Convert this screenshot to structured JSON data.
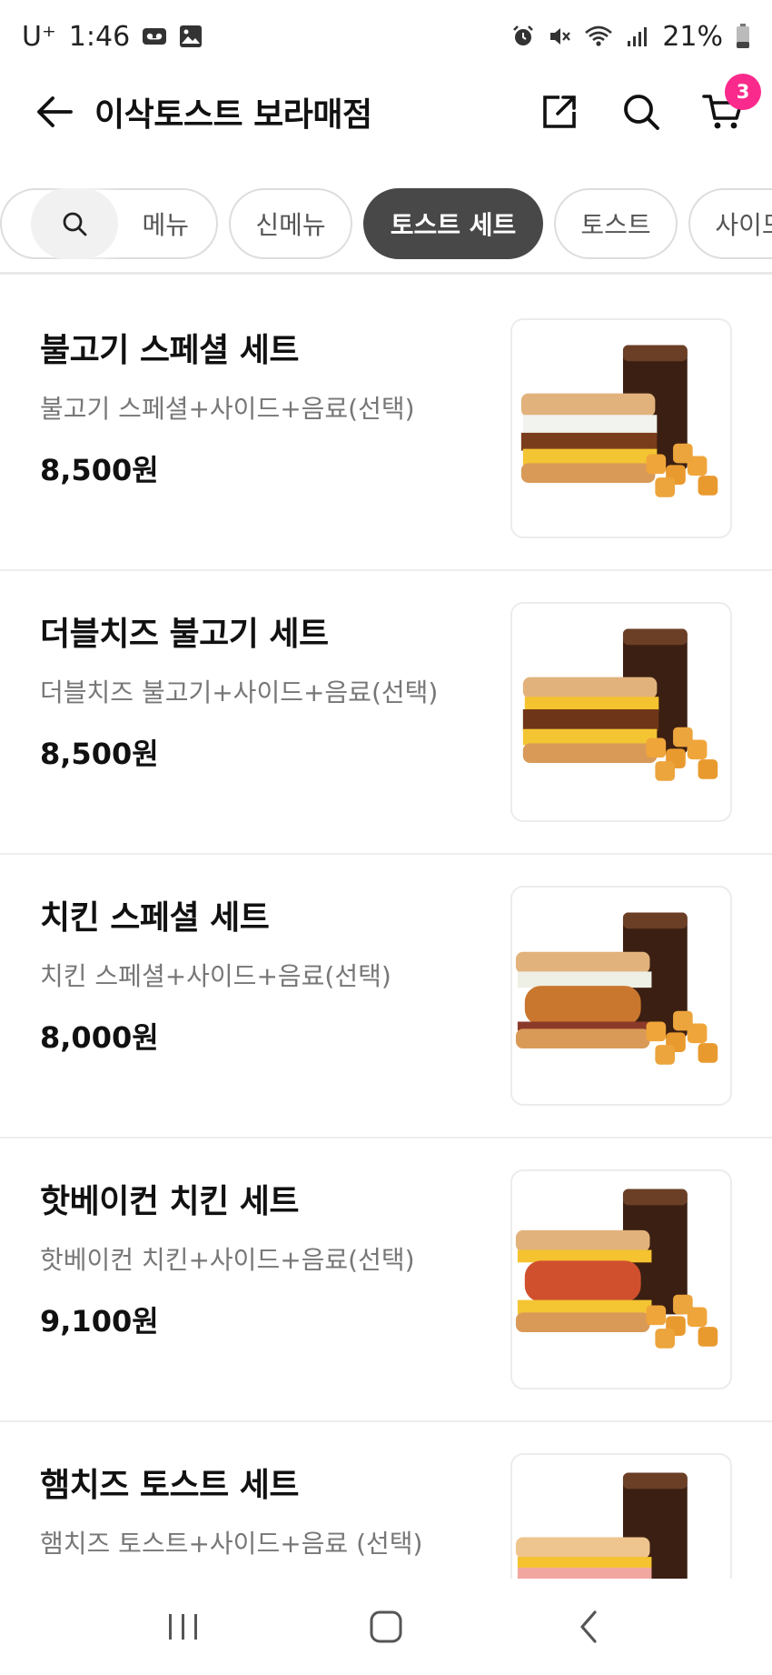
{
  "status_bar": {
    "carrier": "U⁺",
    "time": "1:46",
    "battery": "21%",
    "icons": [
      "voicemail-icon",
      "image-icon",
      "alarm-icon",
      "mute-icon",
      "wifi-icon",
      "signal-icon",
      "battery-icon"
    ]
  },
  "header": {
    "title": "이삭토스트 보라매점",
    "cart_count": "3",
    "icons": [
      "back-arrow-icon",
      "share-icon",
      "search-icon",
      "cart-icon"
    ]
  },
  "tabs": {
    "items": [
      {
        "label": "메뉴",
        "active": false
      },
      {
        "label": "신메뉴",
        "active": false
      },
      {
        "label": "토스트 세트",
        "active": true
      },
      {
        "label": "토스트",
        "active": false
      },
      {
        "label": "사이드",
        "active": false
      },
      {
        "label": "",
        "active": false
      }
    ]
  },
  "menu": {
    "items": [
      {
        "name": "불고기 스페셜 세트",
        "desc": "불고기 스페셜+사이드+음료(선택)",
        "price": "8,500원"
      },
      {
        "name": "더블치즈 불고기 세트",
        "desc": "더블치즈 불고기+사이드+음료(선택)",
        "price": "8,500원"
      },
      {
        "name": "치킨 스페셜 세트",
        "desc": "치킨 스페셜+사이드+음료(선택)",
        "price": "8,000원"
      },
      {
        "name": "핫베이컨 치킨 세트",
        "desc": "핫베이컨 치킨+사이드+음료(선택)",
        "price": "9,100원"
      },
      {
        "name": "햄치즈 토스트 세트",
        "desc": "햄치즈 토스트+사이드+음료 (선택)",
        "price": ""
      }
    ]
  },
  "nav": {
    "icons": [
      "recent-apps-icon",
      "home-icon",
      "back-icon"
    ]
  },
  "colors": {
    "accent_badge": "#fa2a8c",
    "active_tab": "#484848"
  }
}
